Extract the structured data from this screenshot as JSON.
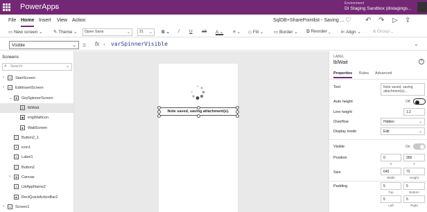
{
  "app": {
    "name": "PowerApps",
    "doc_title": "SqlDB+SharePointlist - Saving ...",
    "environment_label": "Environment",
    "environment_name": "DI Staging Sandbox (distagings..."
  },
  "menu": [
    {
      "label": "File",
      "active": false
    },
    {
      "label": "Home",
      "active": true
    },
    {
      "label": "Insert",
      "active": false
    },
    {
      "label": "View",
      "active": false
    },
    {
      "label": "Action",
      "active": false
    }
  ],
  "ribbon": {
    "new_screen": "New screen",
    "theme": "Theme",
    "font_family": "Open Sans",
    "font_size": "21",
    "bold": "B",
    "italic": "/",
    "underline": "U",
    "strike": "ab",
    "color": "A",
    "fill": "Fill",
    "border": "Border",
    "reorder": "Reorder",
    "align": "Align",
    "group": "Group"
  },
  "formula": {
    "property": "Visible",
    "fx": "fx",
    "expression": "varSpinnerVisible"
  },
  "tree": {
    "title": "Screens",
    "search_placeholder": "Search",
    "nodes": [
      {
        "label": "StartScreen",
        "twisty": "›",
        "icon": "screen"
      },
      {
        "label": "EditInsertScreen",
        "twisty": "›",
        "icon": "screen"
      },
      {
        "label": "GrpSpinnerScreen",
        "twisty": "⌄",
        "icon": "group"
      },
      {
        "label": "lblWait",
        "twisty": "",
        "icon": "label",
        "selected": true
      },
      {
        "label": "imgWaitIcon",
        "twisty": "",
        "icon": "image"
      },
      {
        "label": "WaitScreen",
        "twisty": "",
        "icon": "rect"
      },
      {
        "label": "Button2_1",
        "twisty": "",
        "icon": "button"
      },
      {
        "label": "icon1",
        "twisty": "",
        "icon": "icon"
      },
      {
        "label": "Label1",
        "twisty": "",
        "icon": "label"
      },
      {
        "label": "Button2",
        "twisty": "",
        "icon": "button"
      },
      {
        "label": "Canvas",
        "twisty": "›",
        "icon": "canvas"
      },
      {
        "label": "LblAppName2",
        "twisty": "",
        "icon": "label"
      },
      {
        "label": "RectQuickActionBar2",
        "twisty": "",
        "icon": "rect"
      },
      {
        "label": "Screen1",
        "twisty": "›",
        "icon": "screen"
      }
    ]
  },
  "canvas": {
    "label_text": "Note saved, saving attachment(s)."
  },
  "panel": {
    "kind": "LABEL",
    "name": "lblWait",
    "help": "?",
    "tabs": [
      "Properties",
      "Rules",
      "Advanced"
    ],
    "text_label": "Text",
    "text_value": "Note saved, saving attachment(s)...",
    "auto_height_label": "Auto height",
    "auto_height_state": "Off",
    "line_height_label": "Line height",
    "line_height_value": "1.2",
    "overflow_label": "Overflow",
    "overflow_value": "Hidden",
    "display_mode_label": "Display mode",
    "display_mode_value": "Edit",
    "visible_label": "Visible",
    "visible_state": "On",
    "position_label": "Position",
    "position_x": "0",
    "position_y": "356",
    "x_lbl": "X",
    "y_lbl": "Y",
    "size_label": "Size",
    "width": "640",
    "height": "72",
    "width_lbl": "Width",
    "height_lbl": "Height",
    "padding_label": "Padding",
    "pad_top": "5",
    "pad_bottom": "5",
    "pad_left": "5",
    "pad_right": "5",
    "top_lbl": "Top",
    "bottom_lbl": "Bottom",
    "left_lbl": "Left",
    "right_lbl": "Right"
  },
  "colors": {
    "brand": "#742774",
    "toggle_off": "#252525",
    "toggle_on_disabled": "#c8c8c8"
  }
}
